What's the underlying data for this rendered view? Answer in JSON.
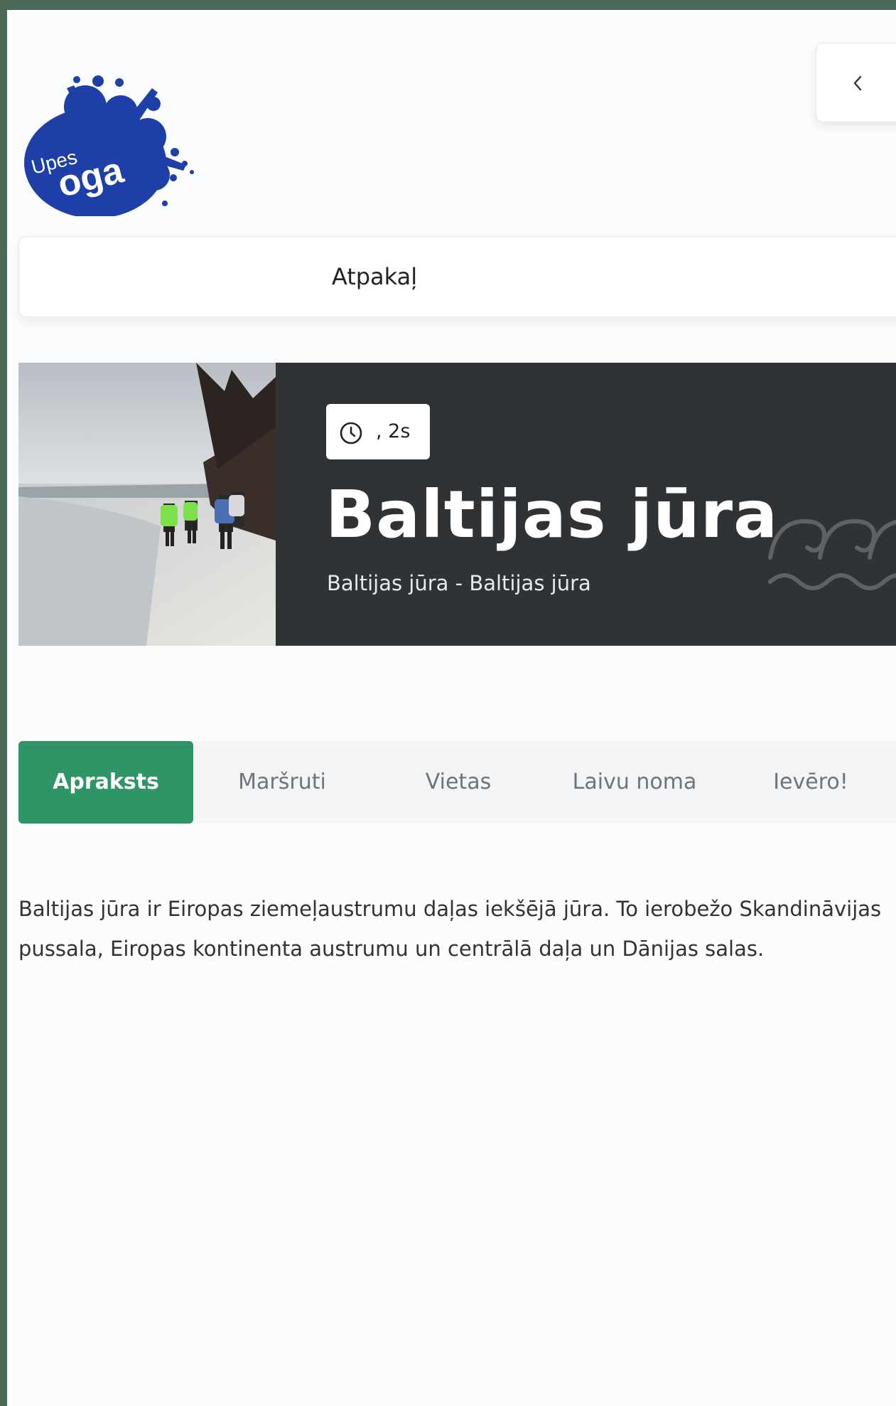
{
  "brand": {
    "logo_line1": "Upes",
    "logo_line2": "oga",
    "logo_color": "#1e3fa8"
  },
  "header": {
    "back_label": "Atpakaļ"
  },
  "hero": {
    "duration": ", 2s",
    "title": "Baltijas jūra",
    "subtitle": "Baltijas jūra - Baltijas jūra",
    "background": "#2f3336"
  },
  "tabs": [
    {
      "label": "Apraksts",
      "active": true
    },
    {
      "label": "Maršruti",
      "active": false
    },
    {
      "label": "Vietas",
      "active": false
    },
    {
      "label": "Laivu noma",
      "active": false
    },
    {
      "label": "Ievēro!",
      "active": false
    }
  ],
  "accent_color": "#2f9466",
  "content": {
    "description": "Baltijas jūra ir Eiropas ziemeļaustrumu daļas iekšējā jūra. To ierobežo Skandināvijas pussala, Eiropas kontinenta austrumu un centrālā daļa un Dānijas salas."
  },
  "icons": {
    "back": "chevron-left-icon",
    "duration": "clock-icon",
    "decor": "waves-icon"
  }
}
